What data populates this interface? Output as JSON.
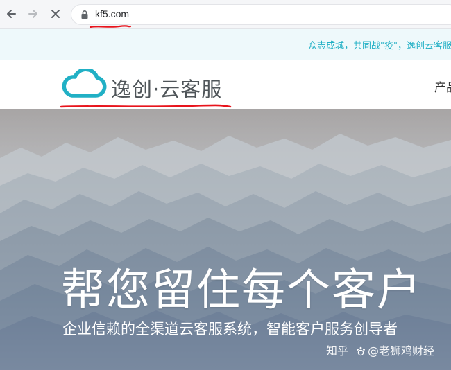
{
  "browser": {
    "url": "kf5.com",
    "status": "loading",
    "icons": [
      "back-arrow-icon",
      "forward-arrow-icon",
      "stop-loading-icon",
      "lock-icon"
    ]
  },
  "notice": {
    "text": "众志成城，共同战\"疫\"，逸创云客服"
  },
  "header": {
    "logo_text": "逸创·云客服",
    "nav_partial": "产品"
  },
  "hero": {
    "headline": "帮您留住每个客户",
    "subheadline": "企业信赖的全渠道云客服系统，智能客户服务创导者"
  },
  "watermark": {
    "platform": "知乎",
    "author": "@老狮鸡财经"
  },
  "colors": {
    "brand_cyan": "#21b0c5",
    "annotation_red": "#e8141c"
  }
}
